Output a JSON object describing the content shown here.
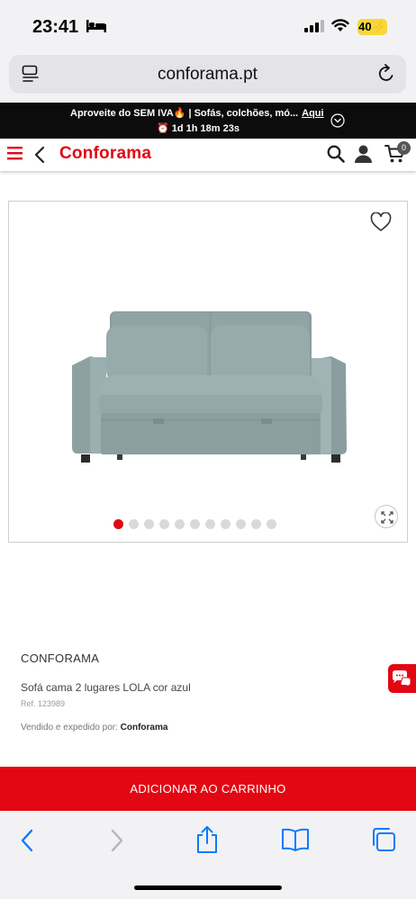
{
  "status_bar": {
    "time": "23:41",
    "battery": "40"
  },
  "browser": {
    "url": "conforama.pt"
  },
  "promo": {
    "text": "Aproveite do SEM IVA🔥 | Sofás, colchões, mó...",
    "link": "Aqui",
    "countdown": "⏰ 1d 1h 18m 23s"
  },
  "header": {
    "logo": "Conforama",
    "cart_count": "0"
  },
  "gallery": {
    "image_count": 11,
    "active_index": 0
  },
  "product": {
    "brand": "CONFORAMA",
    "name": "Sofá cama 2 lugares LOLA cor azul",
    "ref": "Ref. 123989",
    "seller_label": "Vendido e expedido por:",
    "seller": "Conforama"
  },
  "cta": {
    "add_to_cart": "ADICIONAR AO CARRINHO"
  },
  "colors": {
    "brand_red": "#e30613",
    "dot_inactive": "#d9d9d9",
    "ios_blue": "#0a7aff"
  }
}
